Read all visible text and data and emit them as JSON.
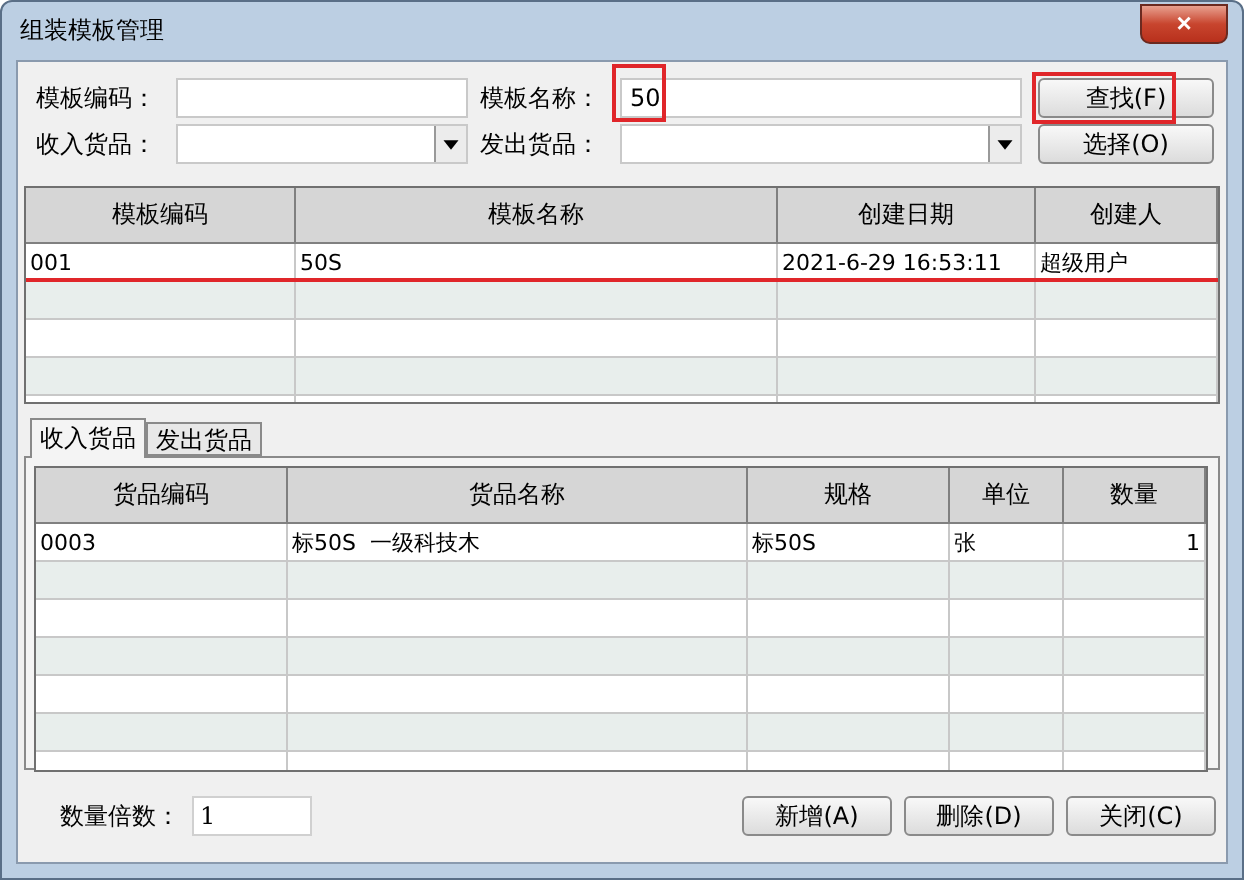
{
  "window": {
    "title": "组装模板管理",
    "close": "×"
  },
  "filters": [
    {
      "kind": "text",
      "label": "模板编码：",
      "highlighted": false
    },
    {
      "kind": "text",
      "label": "模板名称：",
      "value": "50",
      "highlighted": true
    },
    {
      "kind": "combo",
      "label": "收入货品：",
      "highlighted": false
    },
    {
      "kind": "combo",
      "label": "发出货品：",
      "highlighted": false
    }
  ],
  "side_buttons": [
    {
      "label": "查找(F)",
      "highlighted": true
    },
    {
      "label": "选择(O)",
      "highlighted": false
    }
  ],
  "template_table": {
    "columns": [
      "模板编码",
      "模板名称",
      "创建日期",
      "创建人"
    ],
    "rows": [
      {
        "cells": [
          "001",
          "50S",
          "2021-6-29 16:53:11",
          "超级用户"
        ],
        "underlined": true
      }
    ]
  },
  "tabs": [
    {
      "label": "收入货品",
      "selected": true
    },
    {
      "label": "发出货品",
      "selected": false
    }
  ],
  "goods_table": {
    "columns": [
      "货品编码",
      "货品名称",
      "规格",
      "单位",
      "数量"
    ],
    "rows": [
      {
        "cells": [
          "0003",
          "标50S  一级科技木",
          "标50S",
          "张",
          "1"
        ]
      }
    ]
  },
  "multiplier": {
    "label": "数量倍数：",
    "value": "1"
  },
  "buttons": [
    "新增(A)",
    "删除(D)",
    "关闭(C)"
  ]
}
